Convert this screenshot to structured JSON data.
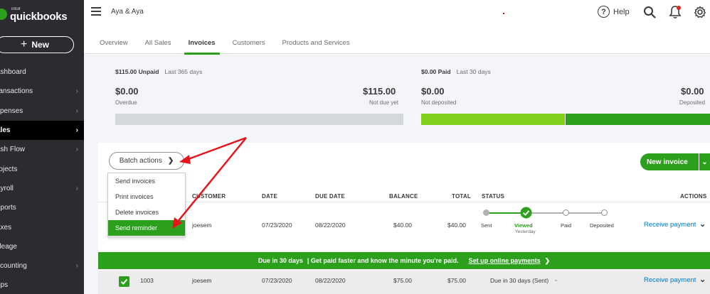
{
  "sidebar": {
    "logo": {
      "small": "intuit",
      "brand": "quickbooks"
    },
    "new_label": "New",
    "items": [
      {
        "label": "ashboard",
        "chevron": false,
        "active": false
      },
      {
        "label": "ransactions",
        "chevron": true,
        "active": false
      },
      {
        "label": "xpenses",
        "chevron": true,
        "active": false
      },
      {
        "label": "ales",
        "chevron": true,
        "active": true
      },
      {
        "label": "ash Flow",
        "chevron": true,
        "active": false
      },
      {
        "label": "rojects",
        "chevron": false,
        "active": false
      },
      {
        "label": "ayroll",
        "chevron": true,
        "active": false
      },
      {
        "label": "eports",
        "chevron": false,
        "active": false
      },
      {
        "label": "axes",
        "chevron": false,
        "active": false
      },
      {
        "label": "lileage",
        "chevron": false,
        "active": false
      },
      {
        "label": "ccounting",
        "chevron": true,
        "active": false
      },
      {
        "label": "pps",
        "chevron": false,
        "active": false
      }
    ]
  },
  "topbar": {
    "company": "Aya & Aya",
    "help_label": "Help",
    "icons": [
      "menu-icon",
      "help-icon",
      "search-icon",
      "bell-icon",
      "gear-icon"
    ]
  },
  "tabs": [
    "Overview",
    "All Sales",
    "Invoices",
    "Customers",
    "Products and Services"
  ],
  "active_tab": "Invoices",
  "summary": {
    "unpaid_label": "$115.00 Unpaid",
    "unpaid_period": "Last 365 days",
    "overdue_amount": "$0.00",
    "overdue_label": "Overdue",
    "notdue_amount": "$115.00",
    "notdue_label": "Not due yet",
    "paid_label": "$0.00 Paid",
    "paid_period": "Last 30 days",
    "notdeposited_amount": "$0.00",
    "notdeposited_label": "Not deposited",
    "deposited_amount": "$0.00",
    "deposited_label": "Deposited"
  },
  "toolbar": {
    "batch_label": "Batch actions",
    "new_invoice_label": "New invoice"
  },
  "batch_menu": [
    "Send invoices",
    "Print invoices",
    "Delete invoices",
    "Send reminder"
  ],
  "table": {
    "headers": {
      "customer": "CUSTOMER",
      "date": "DATE",
      "due_date": "DUE DATE",
      "balance": "BALANCE",
      "total": "TOTAL",
      "status": "STATUS",
      "actions": "ACTIONS"
    },
    "row1": {
      "customer": "joesem",
      "date": "07/23/2020",
      "due_date": "08/22/2020",
      "balance": "$40.00",
      "total": "$40.00",
      "status_steps": [
        "Sent",
        "Viewed",
        "Paid",
        "Deposited"
      ],
      "status_sub": "Yesterday",
      "action": "Receive payment"
    },
    "banner": {
      "due_text": "Due in 30 days",
      "message": "| Get paid faster and know the minute you're paid.",
      "link": "Set up online payments"
    },
    "row2": {
      "number": "1003",
      "customer": "joesem",
      "date": "07/23/2020",
      "due_date": "08/22/2020",
      "balance": "$75.00",
      "total": "$75.00",
      "status": "Due in 30 days (Sent)",
      "action": "Receive payment"
    }
  },
  "colors": {
    "brand_green": "#2ca01c",
    "light_green": "#7fd11b",
    "sidebar": "#2b2c2f",
    "link": "#0077c5",
    "annotation": "#e8141c"
  }
}
